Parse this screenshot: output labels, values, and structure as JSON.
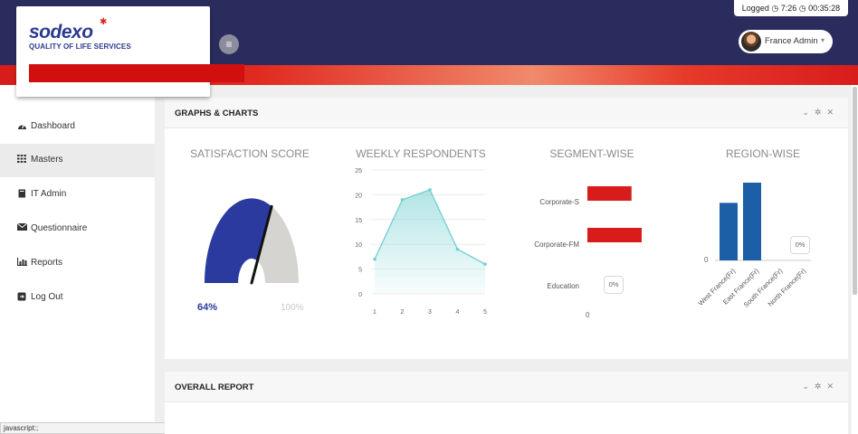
{
  "brand": {
    "logo": "sodexo",
    "tagline": "QUALITY OF LIFE SERVICES"
  },
  "header": {
    "logged_text": "Logged",
    "logged_time": "7:26",
    "session_time": "00:35:28",
    "user_name": "France Admin"
  },
  "sidebar": {
    "items": [
      {
        "label": "Dashboard",
        "icon": "dashboard-icon",
        "active": false
      },
      {
        "label": "Masters",
        "icon": "grid-icon",
        "active": true
      },
      {
        "label": "IT Admin",
        "icon": "book-icon",
        "active": false
      },
      {
        "label": "Questionnaire",
        "icon": "envelope-icon",
        "active": false
      },
      {
        "label": "Reports",
        "icon": "bar-chart-icon",
        "active": false
      },
      {
        "label": "Log Out",
        "icon": "logout-icon",
        "active": false
      }
    ]
  },
  "status_bar": {
    "text": "javascript:;"
  },
  "panels": {
    "graphs": {
      "title": "GRAPHS & CHARTS"
    },
    "overall": {
      "title": "OVERALL REPORT"
    }
  },
  "colors": {
    "navy": "#2b2c5e",
    "red": "#d81c1c",
    "gauge_blue": "#2a3a9e",
    "bar_blue": "#1d5fa6",
    "line_teal": "#73cfd0"
  },
  "chart_data": [
    {
      "type": "gauge",
      "title": "SATISFACTION SCORE",
      "value": 64,
      "value_label": "64%",
      "max_label": "100%"
    },
    {
      "type": "area",
      "title": "WEEKLY RESPONDENTS",
      "x": [
        1,
        2,
        3,
        4,
        5
      ],
      "values": [
        7,
        19,
        21,
        9,
        6
      ],
      "y_ticks": [
        0,
        5,
        10,
        15,
        20,
        25
      ],
      "ylim": [
        0,
        25
      ]
    },
    {
      "type": "bar",
      "orientation": "horizontal",
      "title": "SEGMENT-WISE",
      "categories": [
        "Corporate-S",
        "Corporate-FM",
        "Education"
      ],
      "values": [
        0.65,
        0.8,
        0
      ],
      "axis_zero_label": "0",
      "badge": "0%"
    },
    {
      "type": "bar",
      "title": "REGION-WISE",
      "categories": [
        "West France(Fr)",
        "East France(Fr)",
        "South France(Fr)",
        "North France(Fr)"
      ],
      "values": [
        0.74,
        1.0,
        0,
        0
      ],
      "axis_zero_label": "0",
      "badge": "0%"
    }
  ]
}
